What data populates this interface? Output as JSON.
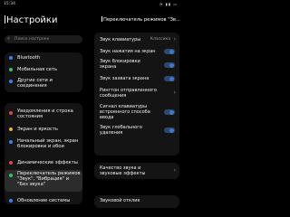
{
  "status_bar": {
    "time": "15:34"
  },
  "settings": {
    "title": "Настройки",
    "search": {
      "placeholder": "Поиск настроек"
    },
    "items": [
      {
        "label": "Bluetooth",
        "color": "#3d7ff5"
      },
      {
        "label": "Мобильная сеть",
        "color": "#39c06a"
      },
      {
        "label": "Другие сети и соединения",
        "color": "#3d7ff5"
      },
      {
        "label": "Уведомления и строка состояния",
        "color": "#e0463b"
      },
      {
        "label": "Экран и яркость",
        "color": "#e2b53c"
      },
      {
        "label": "Начальный экран, экран блокировки и обои",
        "color": "#3d7ff5"
      },
      {
        "label": "Динамические эффекты",
        "color": "#e0463b"
      },
      {
        "label": "Переключатель режимов \"Звук\", \"Вибрация\" и \"Без звука\"",
        "color": "#39c06a"
      },
      {
        "label": "Обновление системы",
        "color": "#3d7ff5"
      }
    ]
  },
  "detail": {
    "title": "Переключатель режимов \"Зв...",
    "rows": [
      {
        "label": "Звук клавиатуры",
        "value": "Классика"
      },
      {
        "label": "Звук нажатия на экран",
        "toggle": true
      },
      {
        "label": "Звук блокировки экрана",
        "toggle": true
      },
      {
        "label": "Звук захвата экрана",
        "toggle": true
      },
      {
        "label": "Рингтон отправленного сообщения"
      },
      {
        "label": "Сигнал клавиатуры встроенного способа ввода",
        "toggle": true
      },
      {
        "label": "Звук глобального удаления",
        "toggle": true
      },
      {
        "label": "Качество звука и звуковые эффекты"
      },
      {
        "label": "Звуковой отклик"
      }
    ]
  }
}
